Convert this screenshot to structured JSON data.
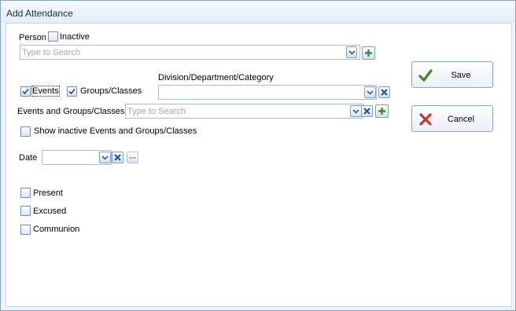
{
  "window": {
    "title": "Add Attendance"
  },
  "person": {
    "label": "Person",
    "inactive_label": "Inactive",
    "inactive_checked": false,
    "search_placeholder": "Type to Search",
    "search_value": ""
  },
  "filters": {
    "events_label": "Events",
    "events_checked": true,
    "groups_label": "Groups/Classes",
    "groups_checked": true
  },
  "division": {
    "label": "Division/Department/Category",
    "value": ""
  },
  "events_groups": {
    "label": "Events and Groups/Classes",
    "placeholder": "Type to Search",
    "value": "",
    "show_inactive_label": "Show inactive Events and Groups/Classes",
    "show_inactive_checked": false
  },
  "date": {
    "label": "Date",
    "value": ""
  },
  "options": [
    {
      "label": "Present",
      "checked": false
    },
    {
      "label": "Excused",
      "checked": false
    },
    {
      "label": "Communion",
      "checked": false
    }
  ],
  "actions": {
    "save_label": "Save",
    "cancel_label": "Cancel"
  },
  "colors": {
    "accent_green": "#3c8a2e",
    "cancel_red": "#c0392b",
    "icon_blue": "#2a5a9a"
  }
}
